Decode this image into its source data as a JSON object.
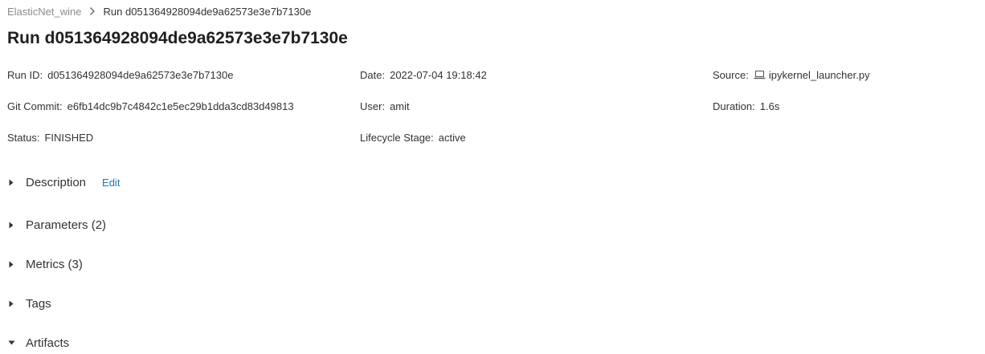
{
  "breadcrumb": {
    "parent": "ElasticNet_wine",
    "current": "Run d051364928094de9a62573e3e7b7130e"
  },
  "title": "Run d051364928094de9a62573e3e7b7130e",
  "metadata": {
    "separator": ":",
    "run_id": {
      "label": "Run ID",
      "value": "d051364928094de9a62573e3e7b7130e"
    },
    "date": {
      "label": "Date",
      "value": "2022-07-04 19:18:42"
    },
    "source": {
      "label": "Source",
      "value": "ipykernel_launcher.py",
      "icon": "laptop-icon"
    },
    "git_commit": {
      "label": "Git Commit",
      "value": "e6fb14dc9b7c4842c1e5ec29b1dda3cd83d49813"
    },
    "user": {
      "label": "User",
      "value": "amit"
    },
    "duration": {
      "label": "Duration",
      "value": "1.6s"
    },
    "status": {
      "label": "Status",
      "value": "FINISHED"
    },
    "lifecycle_stage": {
      "label": "Lifecycle Stage",
      "value": "active"
    }
  },
  "sections": {
    "description": {
      "label": "Description",
      "edit_label": "Edit",
      "expanded": false
    },
    "parameters": {
      "label": "Parameters (2)",
      "expanded": false
    },
    "metrics": {
      "label": "Metrics (3)",
      "expanded": false
    },
    "tags": {
      "label": "Tags",
      "expanded": false
    },
    "artifacts": {
      "label": "Artifacts",
      "expanded": true
    }
  },
  "colors": {
    "link": "#2374bb",
    "muted": "#8c8c8c",
    "text": "#333333"
  }
}
